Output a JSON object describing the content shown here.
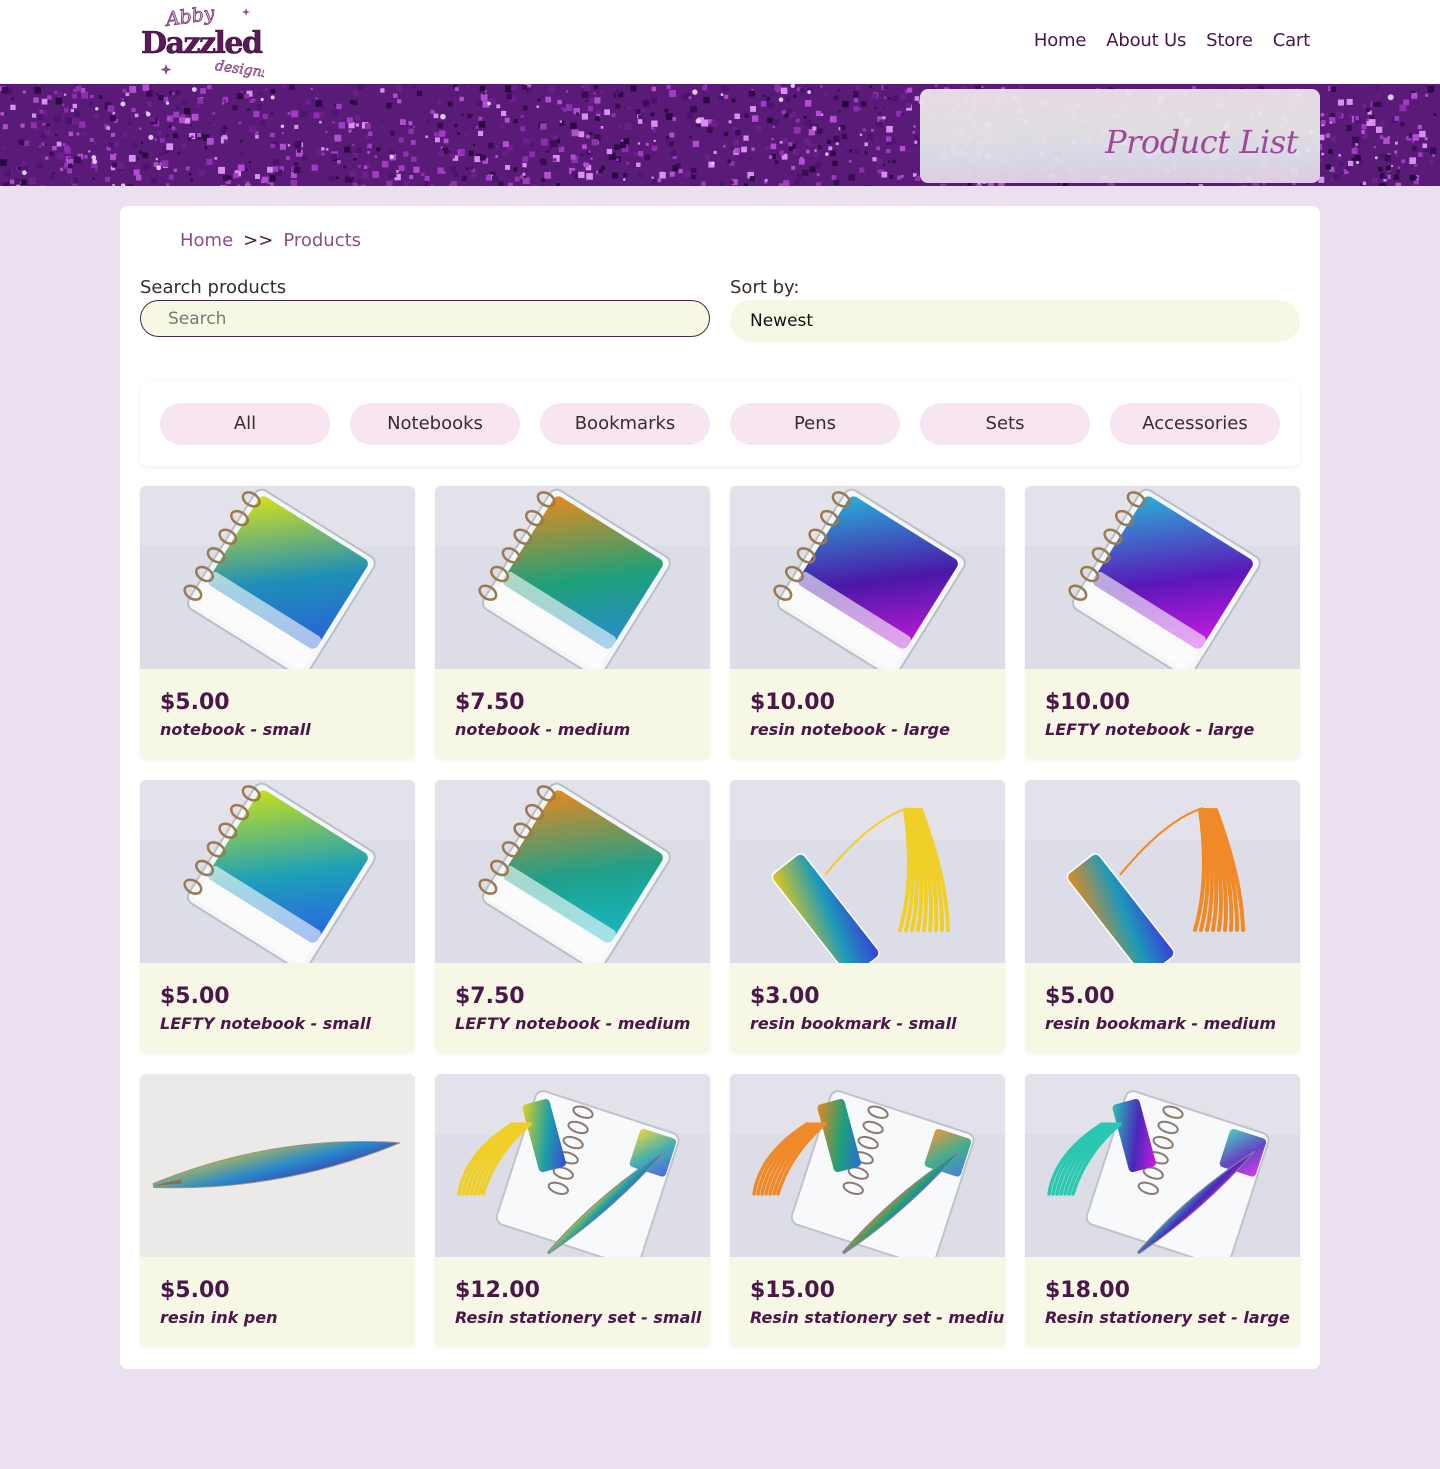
{
  "brand": {
    "logo_top": "Abby",
    "logo_main": "Dazzled",
    "logo_sub": "designs"
  },
  "nav": [
    {
      "label": "Home"
    },
    {
      "label": "About Us"
    },
    {
      "label": "Store"
    },
    {
      "label": "Cart"
    }
  ],
  "banner": {
    "title": "Product List"
  },
  "breadcrumb": {
    "home": "Home",
    "sep": ">>",
    "current": "Products"
  },
  "search": {
    "label": "Search products",
    "placeholder": "Search"
  },
  "sort": {
    "label": "Sort by:",
    "value": "Newest"
  },
  "filters": [
    {
      "label": "All"
    },
    {
      "label": "Notebooks"
    },
    {
      "label": "Bookmarks"
    },
    {
      "label": "Pens"
    },
    {
      "label": "Sets"
    },
    {
      "label": "Accessories"
    }
  ],
  "products": [
    {
      "price": "$5.00",
      "name": "notebook - small",
      "kind": "notebook",
      "colors": [
        "#d8e21a",
        "#1e8fb8",
        "#2a5fd8"
      ]
    },
    {
      "price": "$7.50",
      "name": "notebook - medium",
      "kind": "notebook",
      "colors": [
        "#e88a1c",
        "#1ea07a",
        "#2a8ad8"
      ]
    },
    {
      "price": "$10.00",
      "name": "resin notebook - large",
      "kind": "notebook",
      "colors": [
        "#2ab0d8",
        "#4a18a8",
        "#c21ad8"
      ]
    },
    {
      "price": "$10.00",
      "name": "LEFTY notebook - large",
      "kind": "notebook",
      "colors": [
        "#2ab0d8",
        "#5a18b8",
        "#d21ae8"
      ]
    },
    {
      "price": "$5.00",
      "name": "LEFTY notebook - small",
      "kind": "notebook",
      "colors": [
        "#c8e01a",
        "#1ea0b8",
        "#2a5fe8"
      ]
    },
    {
      "price": "$7.50",
      "name": "LEFTY notebook - medium",
      "kind": "notebook",
      "colors": [
        "#e8881c",
        "#1ea08a",
        "#18b8c8"
      ]
    },
    {
      "price": "$3.00",
      "name": "resin bookmark - small",
      "kind": "bookmark",
      "colors": [
        "#e8c81a",
        "#1e9ab8",
        "#3a3ad8"
      ],
      "tassel": "#f0d028"
    },
    {
      "price": "$5.00",
      "name": "resin bookmark - medium",
      "kind": "bookmark",
      "colors": [
        "#e88a1c",
        "#1e9ab8",
        "#3a3ad8"
      ],
      "tassel": "#f08a28"
    },
    {
      "price": "$5.00",
      "name": "resin ink pen",
      "kind": "pen",
      "colors": [
        "#d8c838",
        "#2a8ac8",
        "#3a28b8"
      ]
    },
    {
      "price": "$12.00",
      "name": "Resin stationery set - small",
      "kind": "set",
      "colors": [
        "#e8d01a",
        "#1ea0a8",
        "#3a48d8"
      ],
      "tassel": "#f0d028"
    },
    {
      "price": "$15.00",
      "name": "Resin stationery set - medium",
      "kind": "set",
      "colors": [
        "#e8881c",
        "#1ea07a",
        "#2a6ad8"
      ],
      "tassel": "#f08a28"
    },
    {
      "price": "$18.00",
      "name": "Resin stationery set - large",
      "kind": "set",
      "colors": [
        "#2ac8b8",
        "#4a28b8",
        "#d21ae8"
      ],
      "tassel": "#2ac8b0"
    }
  ],
  "colors": {
    "page_bg": "#ebe0ef",
    "header_bg": "#ffffff",
    "text_dark": "#4a1748",
    "title_pink": "#a54b9a",
    "card_cream": "#f7f7e6",
    "filter_pink": "#f7e6f1"
  }
}
